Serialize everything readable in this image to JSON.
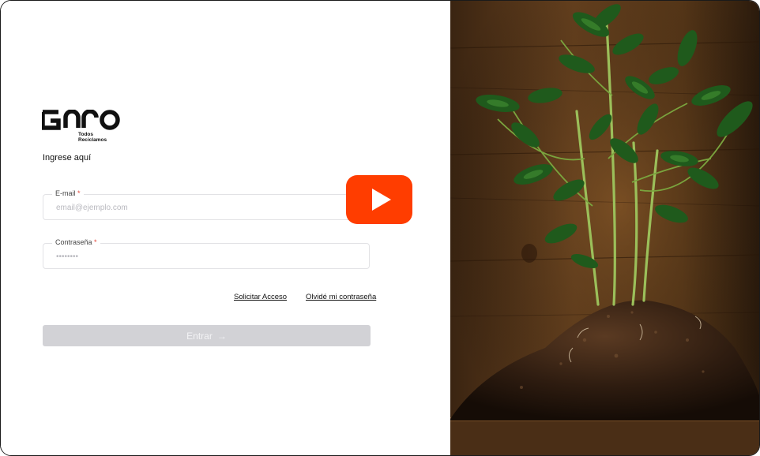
{
  "brand": {
    "logo_text": "GIRO",
    "tagline_line1": "Todos",
    "tagline_line2": "Reciclamos"
  },
  "form": {
    "heading": "Ingrese aquí",
    "email": {
      "label": "E-mail",
      "required_mark": "*",
      "placeholder": "email@ejemplo.com"
    },
    "password": {
      "label": "Contraseña",
      "required_mark": "*",
      "placeholder": "••••••••"
    },
    "links": {
      "request_access": "Solicitar Acceso",
      "forgot_password": "Olvidé mi contraseña"
    },
    "submit": {
      "label": "Entrar",
      "arrow": "→",
      "disabled": true
    }
  },
  "video_overlay": {
    "icon": "youtube-play-icon"
  },
  "colors": {
    "button_disabled": "#d2d2d6",
    "required": "#e0463a",
    "youtube_red": "#ff3d00"
  }
}
